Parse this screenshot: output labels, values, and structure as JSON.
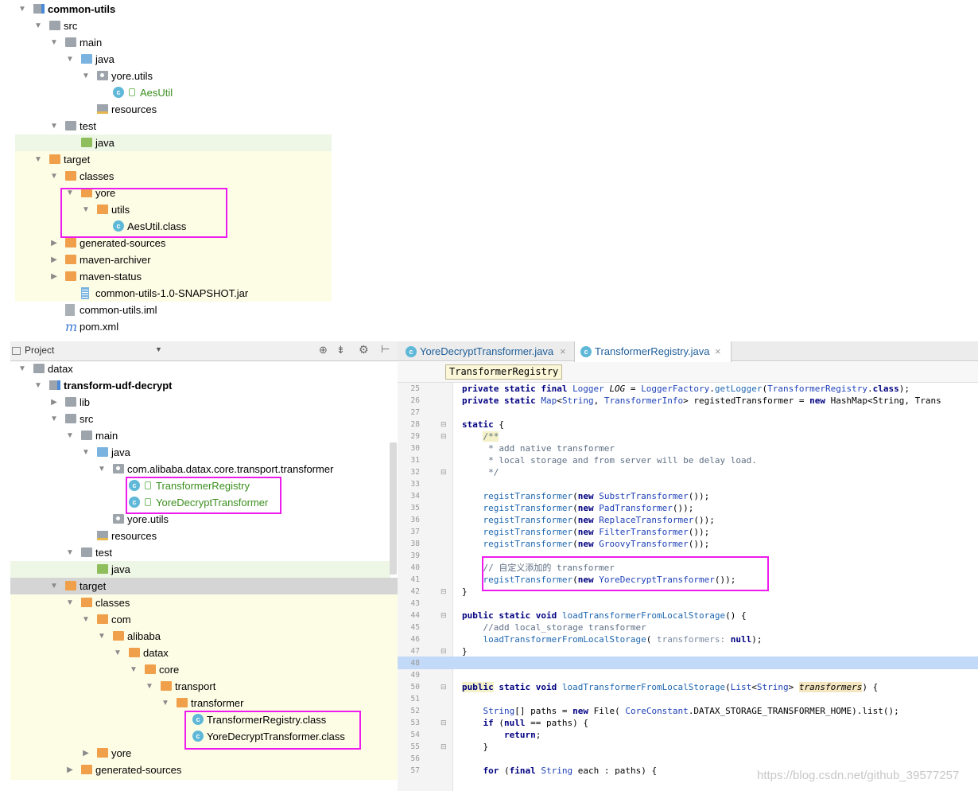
{
  "top_tree": [
    {
      "label": "common-utils",
      "depth": 0,
      "arrow": "down",
      "icon": "module",
      "bold": true
    },
    {
      "label": "src",
      "depth": 1,
      "arrow": "down",
      "icon": "folder-gray"
    },
    {
      "label": "main",
      "depth": 2,
      "arrow": "down",
      "icon": "folder-gray"
    },
    {
      "label": "java",
      "depth": 3,
      "arrow": "down",
      "icon": "folder-blue"
    },
    {
      "label": "yore.utils",
      "depth": 4,
      "arrow": "down",
      "icon": "package"
    },
    {
      "label": "AesUtil",
      "depth": 5,
      "arrow": "",
      "icon": "class",
      "green": true
    },
    {
      "label": "resources",
      "depth": 4,
      "arrow": "",
      "icon": "resources"
    },
    {
      "label": "test",
      "depth": 2,
      "arrow": "down",
      "icon": "folder-gray"
    },
    {
      "label": "java",
      "depth": 3,
      "arrow": "",
      "icon": "folder-green"
    },
    {
      "label": "target",
      "depth": 1,
      "arrow": "down",
      "icon": "folder-orange"
    },
    {
      "label": "classes",
      "depth": 2,
      "arrow": "down",
      "icon": "folder-orange"
    },
    {
      "label": "yore",
      "depth": 3,
      "arrow": "down",
      "icon": "folder-orange"
    },
    {
      "label": "utils",
      "depth": 4,
      "arrow": "down",
      "icon": "folder-orange"
    },
    {
      "label": "AesUtil.class",
      "depth": 5,
      "arrow": "",
      "icon": "classfile"
    },
    {
      "label": "generated-sources",
      "depth": 2,
      "arrow": "right",
      "icon": "folder-orange"
    },
    {
      "label": "maven-archiver",
      "depth": 2,
      "arrow": "right",
      "icon": "folder-orange"
    },
    {
      "label": "maven-status",
      "depth": 2,
      "arrow": "right",
      "icon": "folder-orange"
    },
    {
      "label": "common-utils-1.0-SNAPSHOT.jar",
      "depth": 3,
      "arrow": "",
      "icon": "jar"
    },
    {
      "label": "common-utils.iml",
      "depth": 2,
      "arrow": "",
      "icon": "iml"
    },
    {
      "label": "pom.xml",
      "depth": 2,
      "arrow": "",
      "icon": "maven"
    }
  ],
  "project_panel": {
    "title": "Project",
    "dropdown_icon": "caret-down-icon",
    "toolbar_icons": [
      "target-icon",
      "collapse-icon",
      "gear-icon",
      "pin-icon"
    ]
  },
  "bottom_tree": [
    {
      "label": "datax",
      "depth": 0,
      "arrow": "down",
      "icon": "folder-gray"
    },
    {
      "label": "transform-udf-decrypt",
      "depth": 1,
      "arrow": "down",
      "icon": "module",
      "bold": true
    },
    {
      "label": "lib",
      "depth": 2,
      "arrow": "right",
      "icon": "folder-gray"
    },
    {
      "label": "src",
      "depth": 2,
      "arrow": "down",
      "icon": "folder-gray"
    },
    {
      "label": "main",
      "depth": 3,
      "arrow": "down",
      "icon": "folder-gray"
    },
    {
      "label": "java",
      "depth": 4,
      "arrow": "down",
      "icon": "folder-blue"
    },
    {
      "label": "com.alibaba.datax.core.transport.transformer",
      "depth": 5,
      "arrow": "down",
      "icon": "package"
    },
    {
      "label": "TransformerRegistry",
      "depth": 6,
      "arrow": "",
      "icon": "class",
      "green": true
    },
    {
      "label": "YoreDecryptTransformer",
      "depth": 6,
      "arrow": "",
      "icon": "class",
      "green": true
    },
    {
      "label": "yore.utils",
      "depth": 5,
      "arrow": "",
      "icon": "package"
    },
    {
      "label": "resources",
      "depth": 4,
      "arrow": "",
      "icon": "resources"
    },
    {
      "label": "test",
      "depth": 3,
      "arrow": "down",
      "icon": "folder-gray"
    },
    {
      "label": "java",
      "depth": 4,
      "arrow": "",
      "icon": "folder-green"
    },
    {
      "label": "target",
      "depth": 2,
      "arrow": "down",
      "icon": "folder-orange"
    },
    {
      "label": "classes",
      "depth": 3,
      "arrow": "down",
      "icon": "folder-orange"
    },
    {
      "label": "com",
      "depth": 4,
      "arrow": "down",
      "icon": "folder-orange"
    },
    {
      "label": "alibaba",
      "depth": 5,
      "arrow": "down",
      "icon": "folder-orange"
    },
    {
      "label": "datax",
      "depth": 6,
      "arrow": "down",
      "icon": "folder-orange"
    },
    {
      "label": "core",
      "depth": 7,
      "arrow": "down",
      "icon": "folder-orange"
    },
    {
      "label": "transport",
      "depth": 8,
      "arrow": "down",
      "icon": "folder-orange"
    },
    {
      "label": "transformer",
      "depth": 9,
      "arrow": "down",
      "icon": "folder-orange"
    },
    {
      "label": "TransformerRegistry.class",
      "depth": 10,
      "arrow": "",
      "icon": "classfile"
    },
    {
      "label": "YoreDecryptTransformer.class",
      "depth": 10,
      "arrow": "",
      "icon": "classfile"
    },
    {
      "label": "yore",
      "depth": 4,
      "arrow": "right",
      "icon": "folder-orange"
    },
    {
      "label": "generated-sources",
      "depth": 3,
      "arrow": "right",
      "icon": "folder-orange"
    }
  ],
  "editor": {
    "tabs": [
      {
        "label": "YoreDecryptTransformer.java",
        "close": "×"
      },
      {
        "label": "TransformerRegistry.java",
        "close": "×",
        "active": true
      }
    ],
    "breadcrumb": "TransformerRegistry",
    "class_icon_letter": "c"
  },
  "code_lines": [
    {
      "n": "25",
      "h": "        <span class=\"kw\">private static final</span> <span class=\"ty\">Logger</span> <span class=\"it\">LOG</span> = <span class=\"ty\">LoggerFactory</span>.<span class=\"fn\">getLogger</span>(<span class=\"ty\">TransformerRegistry</span>.<span class=\"kw\">class</span>);"
    },
    {
      "n": "26",
      "h": "        <span class=\"kw\">private static</span> <span class=\"ty\">Map</span>&lt;<span class=\"ty\">String</span>, <span class=\"ty\">TransformerInfo</span>&gt; registedTransformer = <span class=\"kw\">new</span> HashMap&lt;String, Trans"
    },
    {
      "n": "27",
      "h": ""
    },
    {
      "n": "28",
      "h": "        <span class=\"kw\">static</span> {"
    },
    {
      "n": "29",
      "h": "            <span class=\"cm\" style=\"background:#f4f1c8\">/**</span>"
    },
    {
      "n": "30",
      "h": "<span class=\"cm\">             * add native transformer</span>"
    },
    {
      "n": "31",
      "h": "<span class=\"cm\">             * local storage and from server will be delay load.</span>"
    },
    {
      "n": "32",
      "h": "<span class=\"cm\">             */</span>"
    },
    {
      "n": "33",
      "h": ""
    },
    {
      "n": "34",
      "h": "            <span class=\"fn\">registTransformer</span>(<span class=\"kw\">new</span> <span class=\"ty\">SubstrTransformer</span>());"
    },
    {
      "n": "35",
      "h": "            <span class=\"fn\">registTransformer</span>(<span class=\"kw\">new</span> <span class=\"ty\">PadTransformer</span>());"
    },
    {
      "n": "36",
      "h": "            <span class=\"fn\">registTransformer</span>(<span class=\"kw\">new</span> <span class=\"ty\">ReplaceTransformer</span>());"
    },
    {
      "n": "37",
      "h": "            <span class=\"fn\">registTransformer</span>(<span class=\"kw\">new</span> <span class=\"ty\">FilterTransformer</span>());"
    },
    {
      "n": "38",
      "h": "            <span class=\"fn\">registTransformer</span>(<span class=\"kw\">new</span> <span class=\"ty\">GroovyTransformer</span>());"
    },
    {
      "n": "39",
      "h": ""
    },
    {
      "n": "40",
      "h": "            <span class=\"cm\">// 自定义添加的 transformer</span>"
    },
    {
      "n": "41",
      "h": "            <span class=\"fn\">registTransformer</span>(<span class=\"kw\">new</span> <span class=\"ty\">YoreDecryptTransformer</span>());"
    },
    {
      "n": "42",
      "h": "        }"
    },
    {
      "n": "43",
      "h": ""
    },
    {
      "n": "44",
      "h": "        <span class=\"kw\">public static void</span> <span class=\"fn\">loadTransformerFromLocalStorage</span>() {"
    },
    {
      "n": "45",
      "h": "            <span class=\"cm\">//add local_storage transformer</span>"
    },
    {
      "n": "46",
      "h": "            <span class=\"fn\">loadTransformerFromLocalStorage</span>( <span class=\"cmi\">transformers:</span> <span class=\"kw\">null</span>);"
    },
    {
      "n": "47",
      "h": "        }"
    },
    {
      "n": "48",
      "h": "",
      "highlight": true
    },
    {
      "n": "49",
      "h": ""
    },
    {
      "n": "50",
      "h": "        <span class=\"kw\" style=\"background:#f4f1c8\">public</span> <span class=\"kw\">static void</span> <span class=\"fn\">loadTransformerFromLocalStorage</span>(<span class=\"ty\">List</span>&lt;<span class=\"ty\">String</span>&gt; <span class=\"it\" style=\"background:#f4e6c0\">transformers</span>) {"
    },
    {
      "n": "51",
      "h": ""
    },
    {
      "n": "52",
      "h": "            <span class=\"ty\">String</span>[] paths = <span class=\"kw\">new</span> File( <span class=\"ty\">CoreConstant</span>.DATAX_STORAGE_TRANSFORMER_HOME).list();"
    },
    {
      "n": "53",
      "h": "            <span class=\"kw\">if</span> (<span class=\"kw\">null</span> == paths) {"
    },
    {
      "n": "54",
      "h": "                <span class=\"kw\">return</span>;"
    },
    {
      "n": "55",
      "h": "            }"
    },
    {
      "n": "56",
      "h": ""
    },
    {
      "n": "57",
      "h": "            <span class=\"kw\">for</span> (<span class=\"kw\">final</span> <span class=\"ty\">String</span> each : paths) {"
    }
  ],
  "watermark": "https://blog.csdn.net/github_39577257"
}
